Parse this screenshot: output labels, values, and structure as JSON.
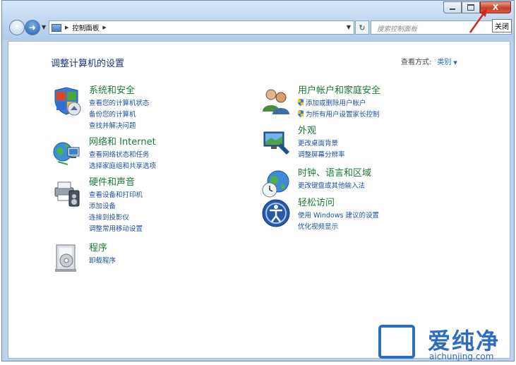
{
  "window": {
    "caption_buttons": [
      "minimize",
      "maximize",
      "close"
    ],
    "tooltip": "关闭",
    "accent_colors": {
      "close": "#c6412b",
      "arrow": "#d2261e",
      "category": "#1a7b38",
      "link": "#1e4fa3"
    }
  },
  "navbar": {
    "breadcrumb": "控制面板",
    "search_placeholder": "搜索控制面板"
  },
  "header": {
    "title": "调整计算机的设置",
    "view_by_label": "查看方式:",
    "view_by_value": "类别"
  },
  "categories": [
    {
      "icon": "system-security-icon",
      "title": "系统和安全",
      "links": [
        "查看您的计算机状态",
        "备份您的计算机",
        "查找并解决问题"
      ]
    },
    {
      "icon": "network-internet-icon",
      "title": "网络和 Internet",
      "links": [
        "查看网络状态和任务",
        "选择家庭组和共享选项"
      ]
    },
    {
      "icon": "hardware-sound-icon",
      "title": "硬件和声音",
      "links": [
        "查看设备和打印机",
        "添加设备",
        "连接到投影仪",
        "调整常用移动设置"
      ]
    },
    {
      "icon": "programs-icon",
      "title": "程序",
      "links": [
        "卸载程序"
      ]
    },
    {
      "icon": "user-accounts-icon",
      "title": "用户帐户和家庭安全",
      "links": [
        "添加或删除用户帐户",
        "为所有用户设置家长控制"
      ]
    },
    {
      "icon": "appearance-icon",
      "title": "外观",
      "links": [
        "更改桌面背景",
        "调整屏幕分辨率"
      ]
    },
    {
      "icon": "clock-region-icon",
      "title": "时钟、语言和区域",
      "links": [
        "更改键盘或其他输入法"
      ]
    },
    {
      "icon": "ease-of-access-icon",
      "title": "轻松访问",
      "links": [
        "使用 Windows 建议的设置",
        "优化视频显示"
      ]
    }
  ],
  "watermark": {
    "text": "爱纯净",
    "url": "aichunjing.com"
  }
}
